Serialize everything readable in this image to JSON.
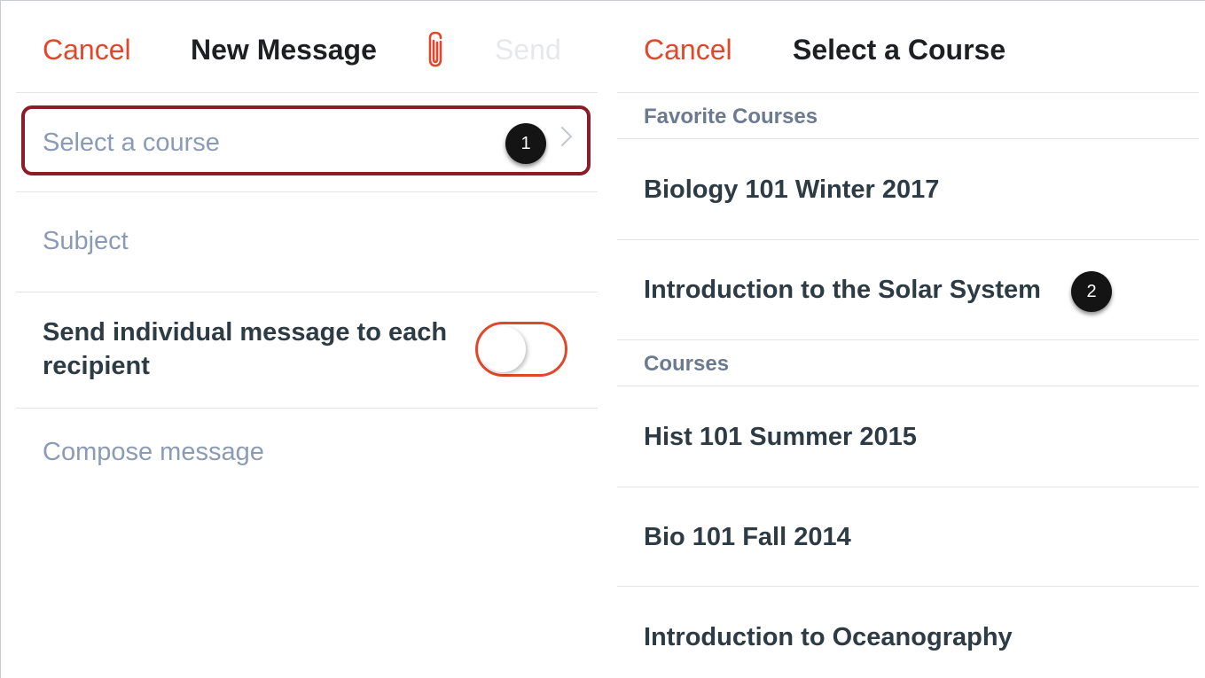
{
  "new_message": {
    "cancel_label": "Cancel",
    "title": "New Message",
    "send_label": "Send",
    "course_placeholder": "Select a course",
    "subject_placeholder": "Subject",
    "individual_toggle_label": "Send individual message to each recipient",
    "individual_toggle_on": false,
    "compose_placeholder": "Compose message",
    "callout": "1"
  },
  "select_course": {
    "cancel_label": "Cancel",
    "title": "Select a Course",
    "favorites_header": "Favorite Courses",
    "favorites": [
      "Biology 101 Winter 2017",
      "Introduction to the Solar System"
    ],
    "courses_header": "Courses",
    "courses": [
      "Hist 101 Summer 2015",
      "Bio 101 Fall 2014",
      "Introduction to Oceanography"
    ],
    "callout": "2"
  },
  "colors": {
    "accent": "#e0472b",
    "highlight_border": "#8c1c28",
    "placeholder": "#8b9bb5",
    "text_dark": "#2d3b45"
  },
  "icons": {
    "attachment": "paperclip-icon",
    "disclosure": "chevron-right-icon"
  }
}
